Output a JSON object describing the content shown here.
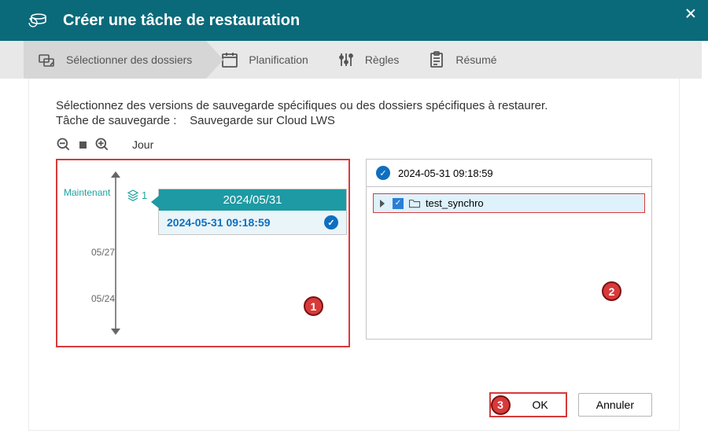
{
  "header": {
    "title": "Créer une tâche de restauration"
  },
  "tabs": {
    "select": "Sélectionner des dossiers",
    "schedule": "Planification",
    "rules": "Règles",
    "summary": "Résumé"
  },
  "main": {
    "instruction": "Sélectionnez des versions de sauvegarde spécifiques ou des dossiers spécifiques à restaurer.",
    "task_label": "Tâche de sauvegarde :",
    "task_name": "Sauvegarde sur Cloud LWS",
    "zoom_unit": "Jour",
    "timeline": {
      "now": "Maintenant",
      "count": "1",
      "ticks": [
        "05/27",
        "05/24"
      ],
      "date_header": "2024/05/31",
      "date_entry": "2024-05-31 09:18:59"
    },
    "folders": {
      "selected_version": "2024-05-31 09:18:59",
      "items": [
        {
          "name": "test_synchro"
        }
      ]
    }
  },
  "badges": {
    "b1": "1",
    "b2": "2",
    "b3": "3"
  },
  "footer": {
    "ok": "OK",
    "cancel": "Annuler"
  }
}
